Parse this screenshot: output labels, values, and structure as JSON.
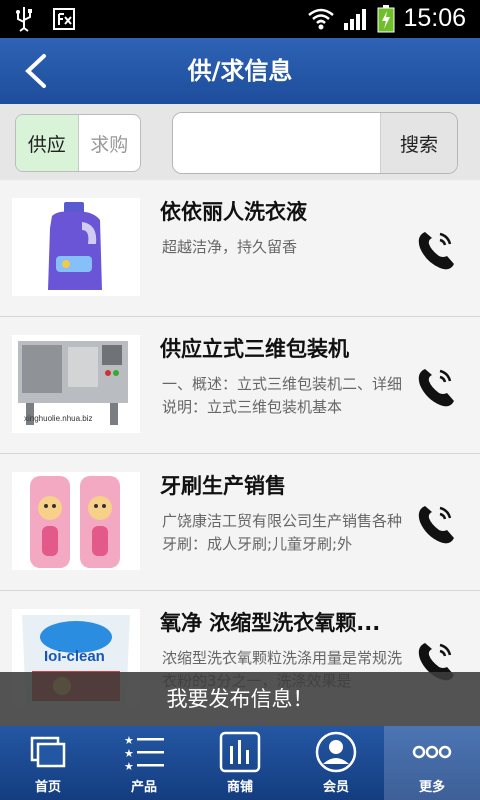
{
  "status_bar": {
    "time": "15:06"
  },
  "header": {
    "title": "供/求信息"
  },
  "filter": {
    "supply_label": "供应",
    "demand_label": "求购"
  },
  "search": {
    "placeholder": "",
    "button_label": "搜索"
  },
  "items": [
    {
      "title": "依依丽人洗衣液",
      "desc": "超越洁净，持久留香"
    },
    {
      "title": "供应立式三维包装机",
      "desc": "一、概述：立式三维包装机二、详细说明：立式三维包装机基本",
      "watermark": "xinghuolie.nhua.biz"
    },
    {
      "title": "牙刷生产销售",
      "desc": "广饶康洁工贸有限公司生产销售各种牙刷：成人牙刷;儿童牙刷;外"
    },
    {
      "title": "氧净 浓缩型洗衣氧颗...",
      "desc": "浓缩型洗衣氧颗粒洗涤用量是常规洗衣粉的3分之一，洗涤效果是",
      "product_text": "Ioi-clean"
    }
  ],
  "publish": {
    "label": "我要发布信息！"
  },
  "tabs": [
    {
      "label": "首页",
      "icon": "home-windows-icon"
    },
    {
      "label": "产品",
      "icon": "star-list-icon"
    },
    {
      "label": "商铺",
      "icon": "bar-chart-icon"
    },
    {
      "label": "会员",
      "icon": "member-avatar-icon"
    },
    {
      "label": "更多",
      "icon": "more-dots-icon"
    }
  ],
  "colors": {
    "header": "#2356a6",
    "tabbar": "#1c4a93",
    "active_filter": "#d8f3d8"
  }
}
